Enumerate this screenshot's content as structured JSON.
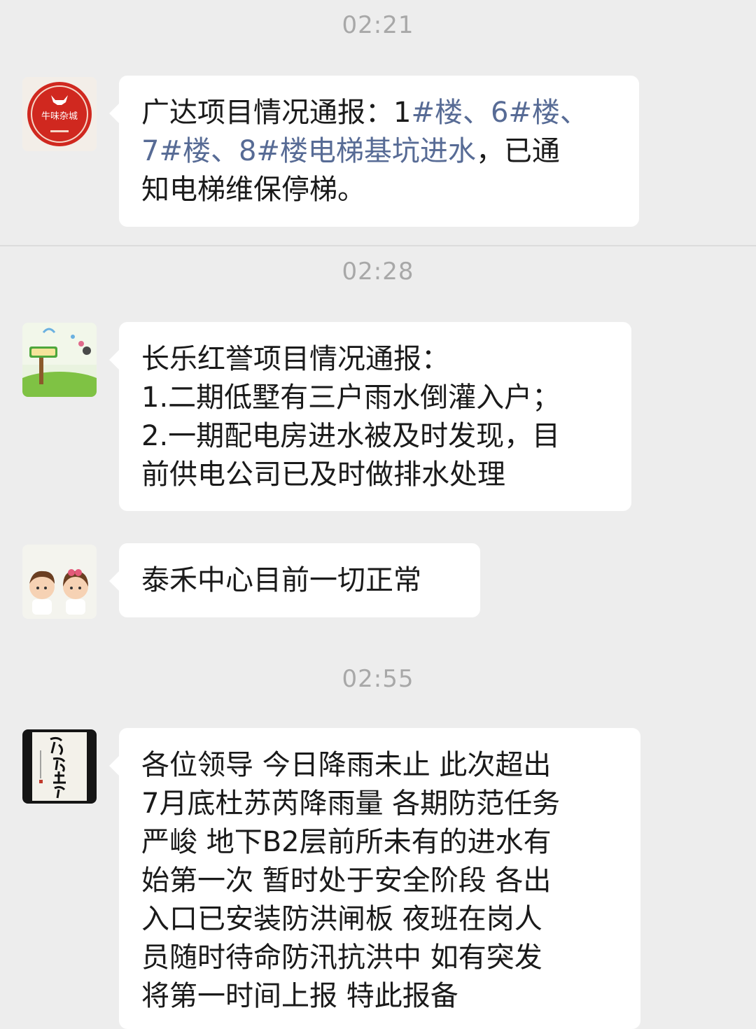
{
  "colors": {
    "background": "#ededed",
    "bubble": "#ffffff",
    "timestamp": "#a8a8a8",
    "link": "#576b95",
    "text": "#1a1a1a"
  },
  "timestamps": [
    "02:21",
    "02:28",
    "02:55"
  ],
  "messages": [
    {
      "avatar": "red-circular-logo-avatar",
      "avatar_text": "牛味杂城",
      "lines": [
        {
          "a": "广达项目情况通报：1",
          "link": "#楼、6#楼、",
          "b": ""
        },
        {
          "a": "",
          "link": "7#楼、8#楼电梯基坑进水",
          "b": "，已通"
        },
        {
          "a": "知电梯维保停梯。",
          "link": "",
          "b": ""
        }
      ]
    },
    {
      "avatar": "cartoon-nature-avatar",
      "lines": [
        "长乐红誉项目情况通报：",
        "1.二期低墅有三户雨水倒灌入户；",
        "2.一期配电房进水被及时发现，目",
        "前供电公司已及时做排水处理"
      ]
    },
    {
      "avatar": "cartoon-couple-avatar",
      "lines": [
        "泰禾中心目前一切正常"
      ]
    },
    {
      "avatar": "calligraphy-avatar",
      "lines": [
        "各位领导  今日降雨未止 此次超出",
        "7月底杜苏芮降雨量  各期防范任务",
        "严峻  地下B2层前所未有的进水有",
        "始第一次  暂时处于安全阶段  各出",
        "入口已安装防洪闸板  夜班在岗人",
        "员随时待命防汛抗洪中 如有突发",
        "将第一时间上报 特此报备"
      ]
    }
  ]
}
